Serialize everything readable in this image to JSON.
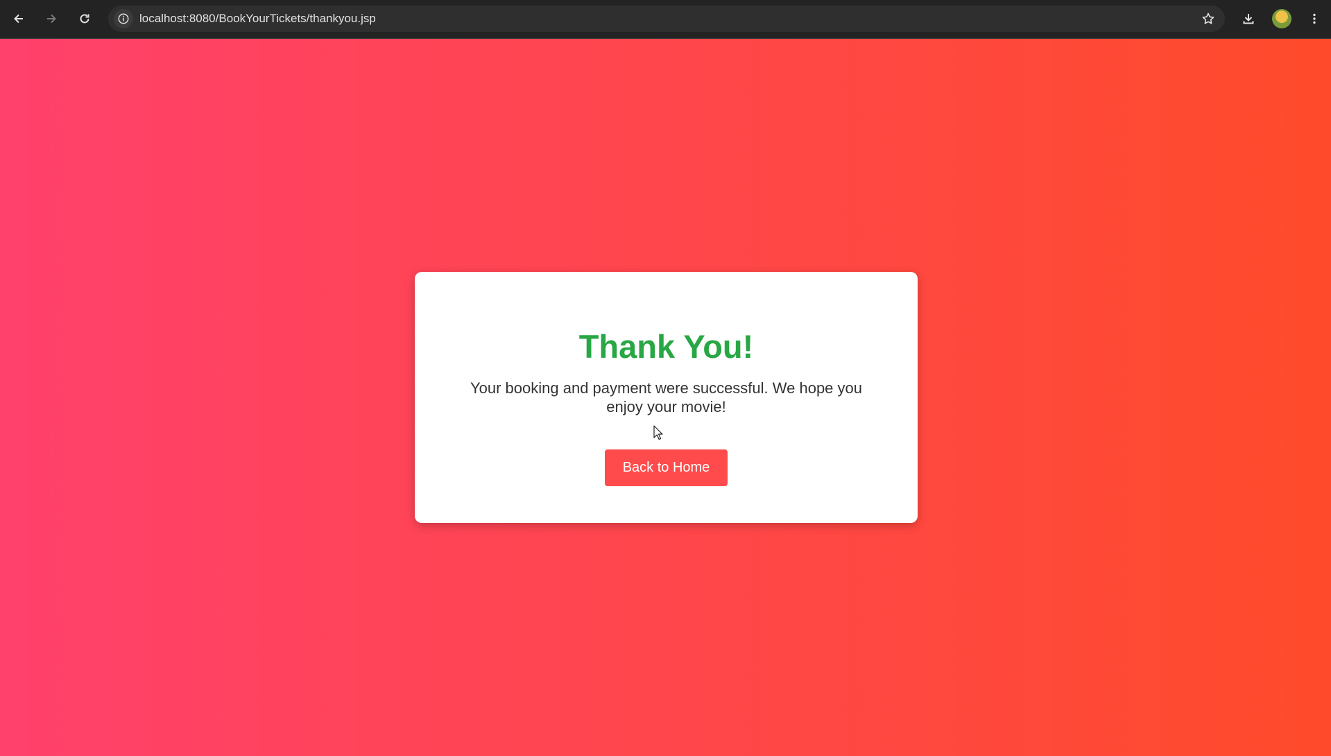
{
  "browser": {
    "url": "localhost:8080/BookYourTickets/thankyou.jsp"
  },
  "card": {
    "heading": "Thank You!",
    "message": "Your booking and payment were successful. We hope you enjoy your movie!",
    "button_label": "Back to Home"
  },
  "colors": {
    "gradient_start": "#ff416c",
    "gradient_end": "#ff4b2b",
    "heading": "#28a745",
    "button": "#ff4b4b"
  },
  "icons": [
    "back-arrow-icon",
    "forward-arrow-icon",
    "reload-icon",
    "site-info-icon",
    "bookmark-star-icon",
    "download-icon",
    "profile-avatar-icon",
    "more-menu-icon",
    "mouse-cursor-icon"
  ]
}
